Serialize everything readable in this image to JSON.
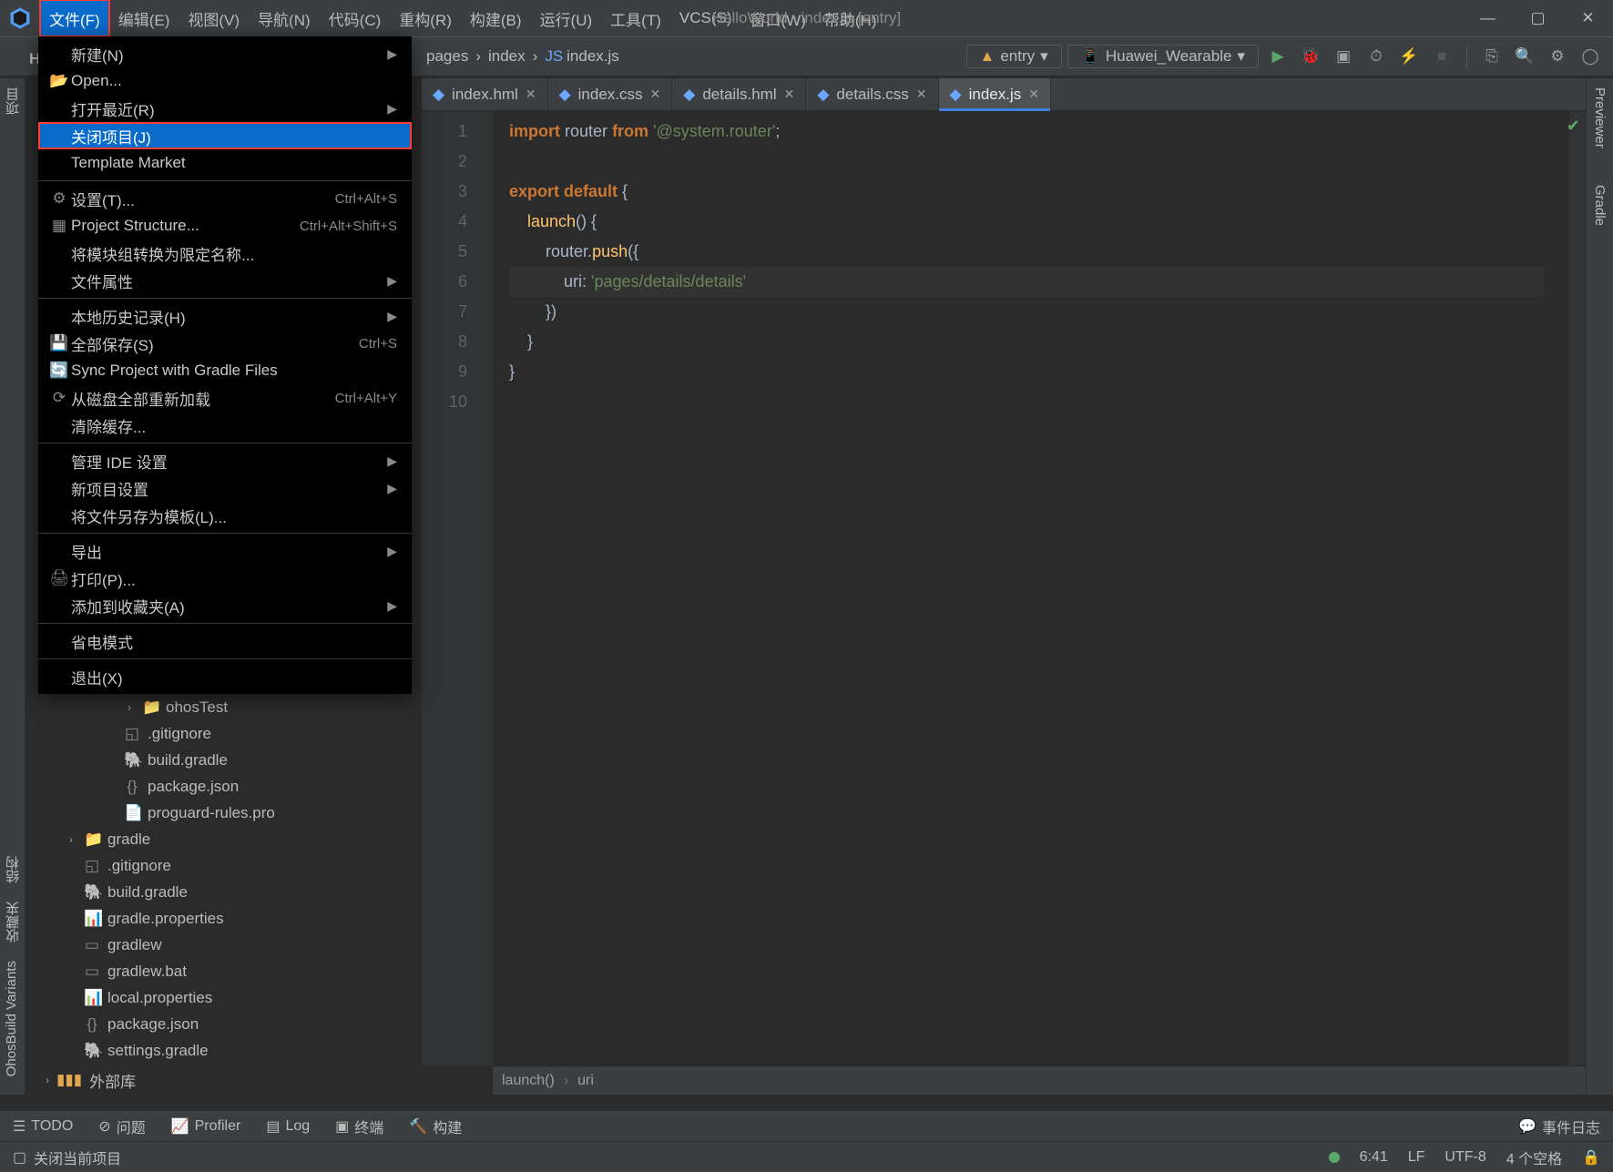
{
  "window_title": "HelloWorld - index.js [entry]",
  "menubar": [
    "文件(F)",
    "编辑(E)",
    "视图(V)",
    "导航(N)",
    "代码(C)",
    "重构(R)",
    "构建(B)",
    "运行(U)",
    "工具(T)",
    "VCS(S)",
    "窗口(W)",
    "帮助(H)"
  ],
  "he_label": "He",
  "breadcrumbs": {
    "a": "pages",
    "b": "index",
    "c": "index.js"
  },
  "run_config": {
    "entry": "entry",
    "device": "Huawei_Wearable"
  },
  "tabs": [
    {
      "label": "index.hml",
      "active": false
    },
    {
      "label": "index.css",
      "active": false
    },
    {
      "label": "details.hml",
      "active": false
    },
    {
      "label": "details.css",
      "active": false
    },
    {
      "label": "index.js",
      "active": true
    }
  ],
  "gutter_lines": [
    "1",
    "2",
    "3",
    "4",
    "5",
    "6",
    "7",
    "8",
    "9",
    "10"
  ],
  "code": {
    "l1_import": "import",
    "l1_router": "router",
    "l1_from": "from",
    "l1_str": "'@system.router'",
    "l1_semi": ";",
    "l3_export": "export",
    "l3_default": "default",
    "l3_brace": " {",
    "l4_launch": "launch",
    "l4_rest": "() {",
    "l5_router": "router",
    "l5_dot": ".",
    "l5_push": "push",
    "l5_rest": "({",
    "l6_uri": "uri",
    "l6_colon": ": ",
    "l6_str": "'pages/details/details'",
    "l7": "})",
    "l8": "}",
    "l9": "}"
  },
  "editor_bc": {
    "a": "launch()",
    "b": "uri"
  },
  "file_menu": [
    {
      "label": "新建(N)",
      "icon": "",
      "shortcut": "",
      "arrow": true
    },
    {
      "label": "Open...",
      "icon": "📂",
      "shortcut": "",
      "arrow": false
    },
    {
      "label": "打开最近(R)",
      "icon": "",
      "shortcut": "",
      "arrow": true
    },
    {
      "label": "关闭项目(J)",
      "icon": "",
      "shortcut": "",
      "arrow": false,
      "highlight": true,
      "redbox": true
    },
    {
      "label": "Template Market",
      "icon": "",
      "shortcut": "",
      "arrow": false
    },
    {
      "sep": true
    },
    {
      "label": "设置(T)...",
      "icon": "⚙",
      "shortcut": "Ctrl+Alt+S",
      "arrow": false
    },
    {
      "label": "Project Structure...",
      "icon": "▦",
      "shortcut": "Ctrl+Alt+Shift+S",
      "arrow": false
    },
    {
      "label": "将模块组转换为限定名称...",
      "icon": "",
      "shortcut": "",
      "arrow": false
    },
    {
      "label": "文件属性",
      "icon": "",
      "shortcut": "",
      "arrow": true
    },
    {
      "sep": true
    },
    {
      "label": "本地历史记录(H)",
      "icon": "",
      "shortcut": "",
      "arrow": true
    },
    {
      "label": "全部保存(S)",
      "icon": "💾",
      "shortcut": "Ctrl+S",
      "arrow": false
    },
    {
      "label": "Sync Project with Gradle Files",
      "icon": "🔄",
      "shortcut": "",
      "arrow": false
    },
    {
      "label": "从磁盘全部重新加载",
      "icon": "⟳",
      "shortcut": "Ctrl+Alt+Y",
      "arrow": false
    },
    {
      "label": "清除缓存...",
      "icon": "",
      "shortcut": "",
      "arrow": false
    },
    {
      "sep": true
    },
    {
      "label": "管理 IDE 设置",
      "icon": "",
      "shortcut": "",
      "arrow": true
    },
    {
      "label": "新项目设置",
      "icon": "",
      "shortcut": "",
      "arrow": true
    },
    {
      "label": "将文件另存为模板(L)...",
      "icon": "",
      "shortcut": "",
      "arrow": false
    },
    {
      "sep": true
    },
    {
      "label": "导出",
      "icon": "",
      "shortcut": "",
      "arrow": true
    },
    {
      "label": "打印(P)...",
      "icon": "🖨",
      "shortcut": "",
      "arrow": false
    },
    {
      "label": "添加到收藏夹(A)",
      "icon": "",
      "shortcut": "",
      "arrow": true
    },
    {
      "sep": true
    },
    {
      "label": "省电模式",
      "icon": "",
      "shortcut": "",
      "arrow": false
    },
    {
      "sep": true
    },
    {
      "label": "退出(X)",
      "icon": "",
      "shortcut": "",
      "arrow": false
    }
  ],
  "tree": [
    {
      "ind": "ind2",
      "tog": "›",
      "icon": "📁",
      "label": "ohosTest"
    },
    {
      "ind": "ind1",
      "tog": "",
      "icon": "◱",
      "label": ".gitignore"
    },
    {
      "ind": "ind1",
      "tog": "",
      "icon": "🐘",
      "label": "build.gradle"
    },
    {
      "ind": "ind1",
      "tog": "",
      "icon": "{}",
      "label": "package.json"
    },
    {
      "ind": "ind1",
      "tog": "",
      "icon": "📄",
      "label": "proguard-rules.pro"
    },
    {
      "ind": "ind0",
      "tog": "›",
      "icon": "📁",
      "label": "gradle"
    },
    {
      "ind": "ind0",
      "tog": "",
      "icon": "◱",
      "label": ".gitignore"
    },
    {
      "ind": "ind0",
      "tog": "",
      "icon": "🐘",
      "label": "build.gradle"
    },
    {
      "ind": "ind0",
      "tog": "",
      "icon": "📊",
      "label": "gradle.properties"
    },
    {
      "ind": "ind0",
      "tog": "",
      "icon": "▭",
      "label": "gradlew"
    },
    {
      "ind": "ind0",
      "tog": "",
      "icon": "▭",
      "label": "gradlew.bat"
    },
    {
      "ind": "ind0",
      "tog": "",
      "icon": "📊",
      "label": "local.properties"
    },
    {
      "ind": "ind0",
      "tog": "",
      "icon": "{}",
      "label": "package.json"
    },
    {
      "ind": "ind0",
      "tog": "",
      "icon": "🐘",
      "label": "settings.gradle"
    }
  ],
  "ext_lib": "外部库",
  "ext_lib_tog": "›",
  "left_rail": {
    "project": "项目",
    "struct": "结构",
    "fav": "收藏夹",
    "ohos": "OhosBuild Variants"
  },
  "right_rail": {
    "prev": "Previewer",
    "gradle": "Gradle"
  },
  "tw_items": {
    "todo": "TODO",
    "problems": "问题",
    "profiler": "Profiler",
    "log": "Log",
    "terminal": "终端",
    "build": "构建",
    "events": "事件日志"
  },
  "status": {
    "msg": "关闭当前项目",
    "pos": "6:41",
    "le": "LF",
    "enc": "UTF-8",
    "indent": "4 个空格"
  }
}
